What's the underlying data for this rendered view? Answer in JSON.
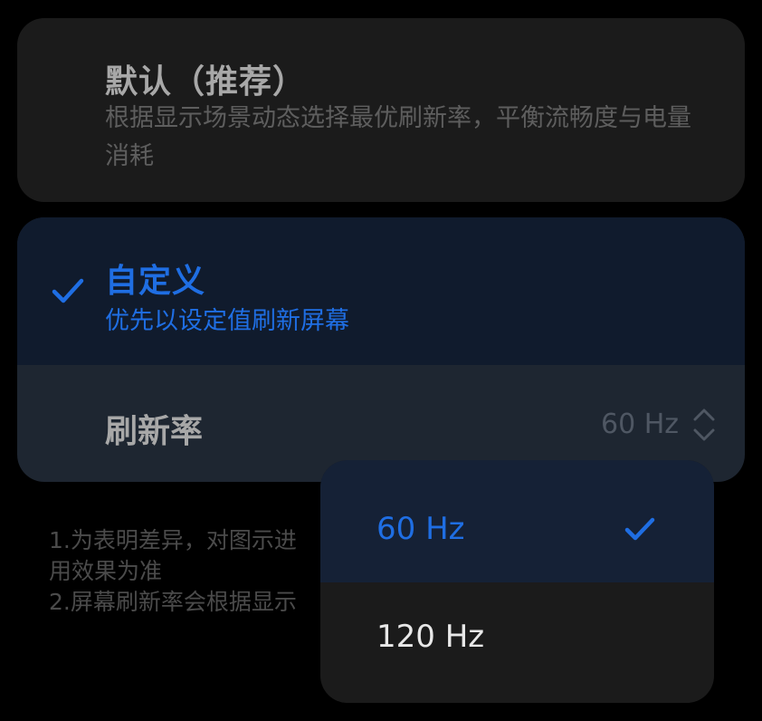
{
  "default_option": {
    "title": "默认（推荐）",
    "description": "根据显示场景动态选择最优刷新率，平衡流畅度与电量消耗"
  },
  "custom_option": {
    "title": "自定义",
    "description": "优先以设定值刷新屏幕",
    "selected": true,
    "refresh_rate_label": "刷新率",
    "refresh_rate_value": "60 Hz"
  },
  "notes": {
    "line1": "1.为表明差异，对图示进",
    "line2": "用效果为准",
    "line3": "2.屏幕刷新率会根据显示"
  },
  "dropdown": {
    "options": [
      {
        "label": "60 Hz",
        "selected": true
      },
      {
        "label": "120 Hz",
        "selected": false
      }
    ]
  },
  "colors": {
    "accent": "#1f6ee3",
    "background": "#000000",
    "card": "#1b1b1b",
    "selected_card": "#101b2d"
  }
}
